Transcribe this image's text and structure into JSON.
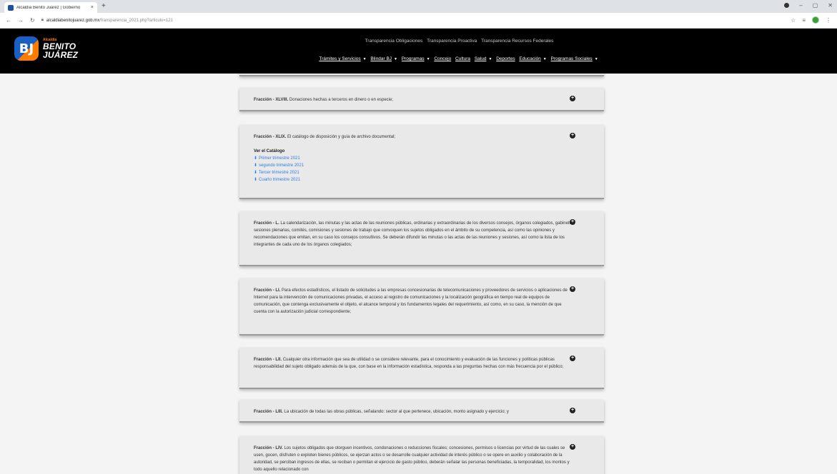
{
  "browser": {
    "tab_title": "Alcaldía Benito Juárez | Gobierno",
    "tab_close": "×",
    "new_tab": "+",
    "url_host": "alcaldiabenitojuarez.gob.mx",
    "url_path": "/transparencia_2021.php?articulo=121"
  },
  "logo": {
    "mark": "BJ",
    "small": "Alcaldía",
    "line1": "BENITO",
    "line2": "JUÁREZ"
  },
  "top_links": [
    "Transparencia Obligaciones",
    "Transparencia Proactiva",
    "Transparencia Recursos Federales"
  ],
  "main_nav": [
    {
      "label": "Trámites y Servicios",
      "dropdown": true
    },
    {
      "label": "Blindar BJ",
      "dropdown": true
    },
    {
      "label": "Programas",
      "dropdown": true
    },
    {
      "label": "Concejo",
      "dropdown": false
    },
    {
      "label": "Cultura",
      "dropdown": false
    },
    {
      "label": "Salud",
      "dropdown": true
    },
    {
      "label": "Deportes",
      "dropdown": false
    },
    {
      "label": "Educación",
      "dropdown": true
    },
    {
      "label": "Programas Sociales",
      "dropdown": true
    }
  ],
  "fractions": [
    {
      "label": "Fracción - XLVIII.",
      "text": "Donaciones hechas a terceros en dinero o en especie;"
    },
    {
      "label": "Fracción - XLIX.",
      "text": "El catálogo de disposición y guía de archivo documental;",
      "catalog_title": "Ver el Catálogo",
      "links": [
        "Primer trimestre 2021",
        "segundo trimestre 2021",
        "Tercer trimestre 2021",
        "Cuarto trimestre 2021"
      ]
    },
    {
      "label": "Fracción - L.",
      "text": "La calendarización, las minutas y las actas de las reuniones públicas, ordinarias y extraordinarias de los diversos consejos, órganos colegiados, gabinetes, sesiones plenarias, comités, comisiones y sesiones de trabajo que convoquen los sujetos obligados en el ámbito de su competencia, así como las opiniones y recomendaciones que emitan, en su caso los consejos consultivos. Se deberán difundir las minutas o las actas de las reuniones y sesiones, así como la lista de los integrantes de cada uno de los órganos colegiados;"
    },
    {
      "label": "Fracción - LI.",
      "text": "Para efectos estadísticos, el listado de solicitudes a las empresas concesionarias de telecomunicaciones y proveedores de servicios o aplicaciones de Internet para la intervención de comunicaciones privadas, el acceso al registro de comunicaciones y la localización geográfica en tiempo real de equipos de comunicación, que contenga exclusivamente el objeto, el alcance temporal y los fundamentos legales del requerimiento, así como, en su caso, la mención de que cuenta con la autorización judicial correspondiente;"
    },
    {
      "label": "Fracción - LII.",
      "text": "Cualquier otra información que sea de utilidad o se considere relevante, para el conocimiento y evaluación de las funciones y políticas públicas responsabilidad del sujeto obligado además de la que, con base en la información estadística, responda a las preguntas hechas con más frecuencia por el público;"
    },
    {
      "label": "Fracción - LIII.",
      "text": "La ubicación de todas las obras públicas, señalando: sector al que pertenece, ubicación, monto asignado y ejercicio; y"
    },
    {
      "label": "Fracción - LIV.",
      "text": "Los sujetos obligados que otorguen incentivos, condonaciones o reducciones fiscales; concesiones, permisos o licencias por virtud de las cuales se usen, gocen, disfruten o exploten bienes públicos, se ejerzan actos o se desarrolle cualquier actividad de interés público o se opere en auxilio y colaboración de la autoridad, se perciban ingresos de ellas, se reciban o permitan el ejercicio de gasto público, deberán señalar las personas beneficiadas, la temporalidad, los montos y todo aquello relacionado con"
    }
  ],
  "colors": {
    "header_bg": "#000000",
    "link": "#2a7ee6",
    "card_bg": "#e9e9e9"
  }
}
